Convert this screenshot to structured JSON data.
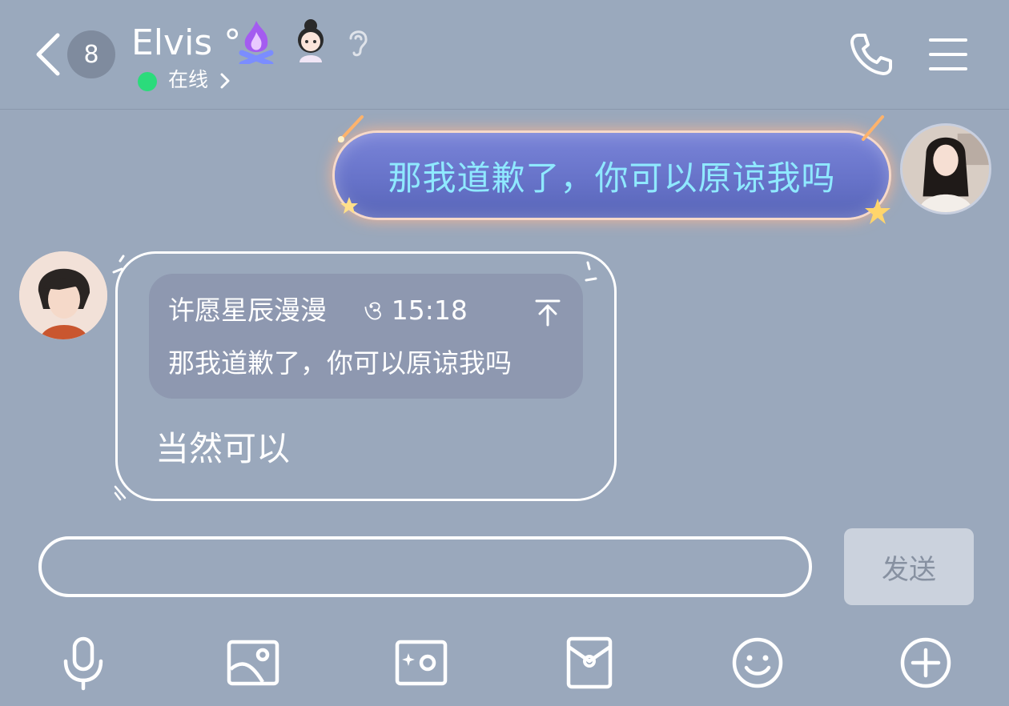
{
  "header": {
    "back_icon": "chevron-left-icon",
    "unread_count": "8",
    "contact_name": "Elvis °",
    "status_text": "在线",
    "phone_icon": "phone-icon",
    "menu_icon": "menu-icon"
  },
  "messages": {
    "outgoing": {
      "text": "那我道歉了，你可以原谅我吗"
    },
    "incoming": {
      "quote": {
        "sender": "许愿星辰漫漫",
        "time": "ও 15:18",
        "text": "那我道歉了，你可以原谅我吗"
      },
      "text": "当然可以"
    }
  },
  "composer": {
    "input_value": "",
    "send_label": "发送"
  },
  "toolbar": {
    "items": [
      "microphone-icon",
      "image-icon",
      "camera-icon",
      "red-envelope-icon",
      "emoji-icon",
      "plus-icon"
    ]
  },
  "colors": {
    "background": "#9aa8bc",
    "online": "#2bdb7b",
    "outgoing_text": "#8fe9ff",
    "send_button": "#cbd2dd"
  }
}
